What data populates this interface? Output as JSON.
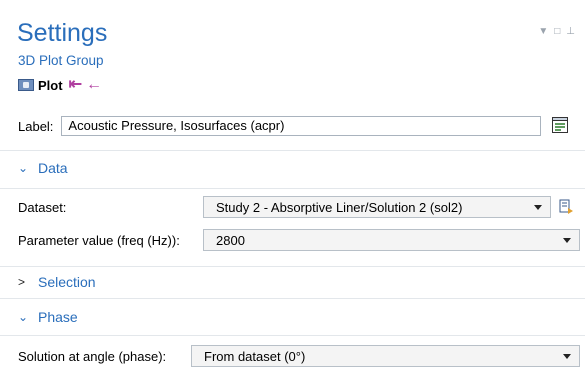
{
  "header": {
    "title": "Settings",
    "subtitle": "3D Plot Group",
    "plot_label": "Plot",
    "first_arrow": "⇤",
    "back_arrow": "←"
  },
  "label_field": {
    "label": "Label:",
    "value": "Acoustic Pressure, Isosurfaces (acpr)"
  },
  "sections": {
    "data": {
      "title": "Data",
      "chevron": "⌄",
      "dataset_label": "Dataset:",
      "dataset_value": "Study 2 - Absorptive Liner/Solution 2 (sol2)",
      "param_label": "Parameter value (freq (Hz)):",
      "param_value": "2800"
    },
    "selection": {
      "title": "Selection",
      "chevron": ">"
    },
    "phase": {
      "title": "Phase",
      "chevron": "⌄",
      "angle_label": "Solution at angle (phase):",
      "angle_value": "From dataset (0°)"
    }
  },
  "colors": {
    "accent": "#2a6ebb",
    "arrow": "#b03fa0"
  },
  "icons": {
    "plot": "plot-icon",
    "label_button": "label-edit-icon",
    "dataset_button": "dataset-goto-icon"
  }
}
